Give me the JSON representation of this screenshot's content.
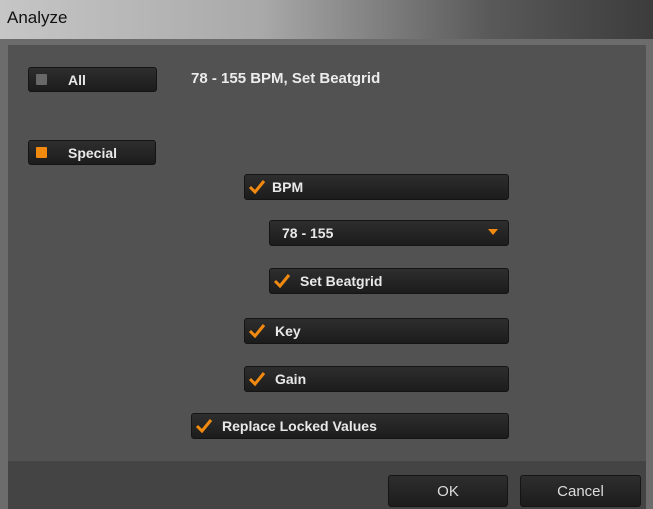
{
  "window": {
    "title": "Analyze"
  },
  "mode": {
    "all_label": "All",
    "all_summary": "78 - 155 BPM, Set Beatgrid",
    "special_label": "Special"
  },
  "options": {
    "bpm_label": "BPM",
    "bpm_range": "78 - 155",
    "set_beatgrid_label": "Set Beatgrid",
    "key_label": "Key",
    "gain_label": "Gain",
    "replace_locked_label": "Replace Locked Values"
  },
  "footer": {
    "ok_label": "OK",
    "cancel_label": "Cancel"
  },
  "colors": {
    "accent": "#f28a10",
    "button": "#232323",
    "panel": "#525252"
  },
  "icons": {
    "check": "check-icon",
    "dropdown": "chevron-down-icon"
  }
}
